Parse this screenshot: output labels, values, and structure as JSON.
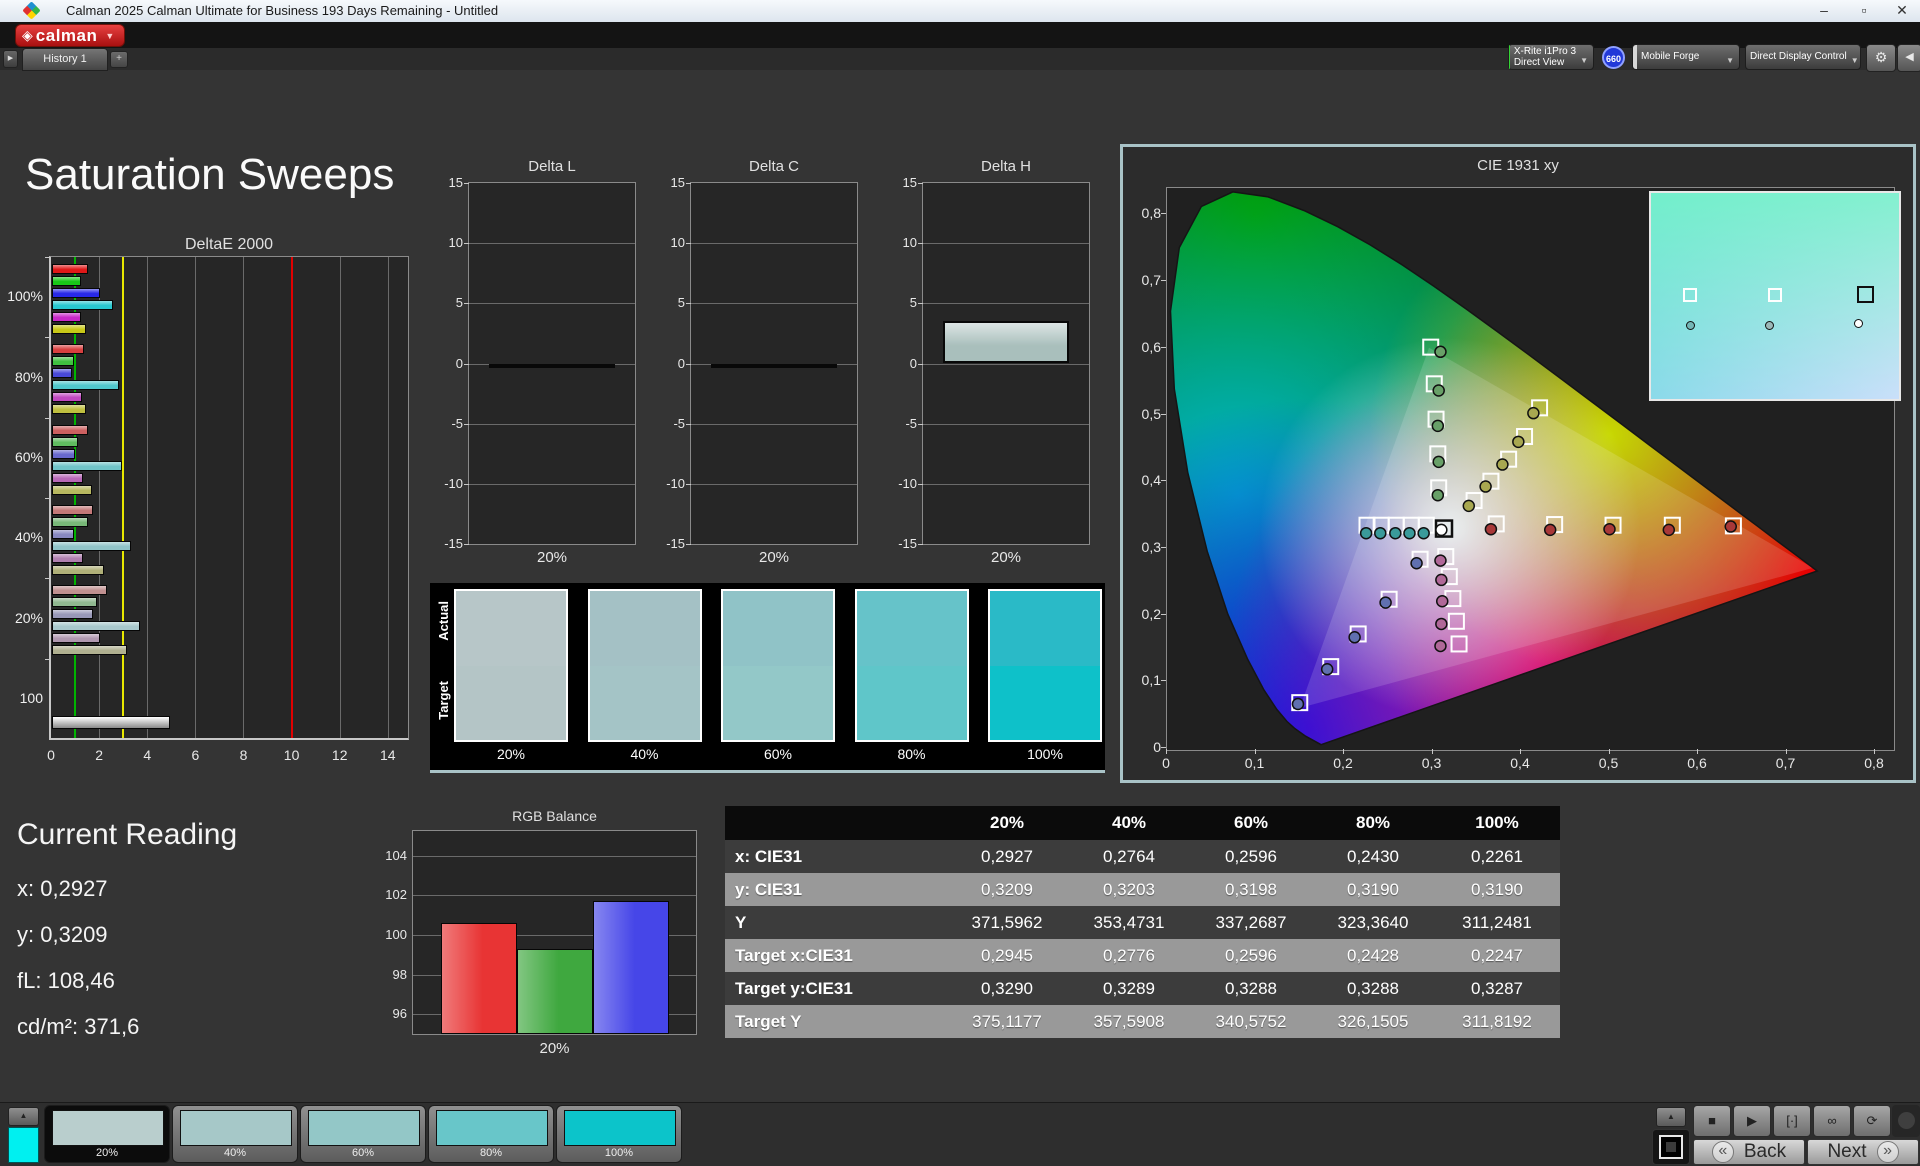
{
  "window": {
    "title": "Calman 2025 Calman Ultimate for Business 193 Days Remaining  - Untitled",
    "minimize": "–",
    "maximize": "▫",
    "close": "✕"
  },
  "logo": {
    "text": "calman",
    "diamond": "◈",
    "caret": "▼"
  },
  "tabs": {
    "scroll_arrow": "▶",
    "history_tab": "History 1",
    "add_tab": "+"
  },
  "toolbar": {
    "meter_line1": "X-Rite i1Pro 3",
    "meter_line2": "Direct View",
    "meter_stripe": "#35d435",
    "badge": "660",
    "source_label": "Mobile Forge",
    "source_stripe": "#d8d8d8",
    "display_label": "Direct Display Control",
    "display_stripe": "#e8d820",
    "gear_icon": "⚙",
    "collapse_icon": "◀",
    "caret": "▼"
  },
  "page": {
    "title": "Saturation Sweeps"
  },
  "current_reading": {
    "title": "Current Reading",
    "lines": [
      {
        "label": "x:",
        "value": "0,2927"
      },
      {
        "label": "y:",
        "value": "0,3209"
      },
      {
        "label": "fL:",
        "value": "108,46"
      },
      {
        "label": "cd/m²:",
        "value": "371,6"
      }
    ]
  },
  "swatches": {
    "row_labels": [
      "Actual",
      "Target"
    ],
    "levels": [
      {
        "label": "20%",
        "actual": "#b7c6c8",
        "target": "#b4c5c6"
      },
      {
        "label": "40%",
        "actual": "#a4c1c5",
        "target": "#a4c4c6"
      },
      {
        "label": "60%",
        "actual": "#90c3c7",
        "target": "#93c8c8"
      },
      {
        "label": "80%",
        "actual": "#66c3c9",
        "target": "#5fc6c9"
      },
      {
        "label": "100%",
        "actual": "#2abac7",
        "target": "#0ec1c9"
      }
    ]
  },
  "chart_data": [
    {
      "id": "deltae2000",
      "type": "bar",
      "orientation": "horizontal",
      "title": "DeltaE 2000",
      "xlim": [
        0,
        14.88
      ],
      "xticks": [
        0,
        2,
        4,
        6,
        8,
        10,
        12,
        14
      ],
      "grid": true,
      "reference_lines": [
        {
          "value": 1,
          "color": "#00b400"
        },
        {
          "value": 3,
          "color": "#e8e800"
        },
        {
          "value": 10,
          "color": "#e00000"
        }
      ],
      "series_names": [
        "red",
        "green",
        "blue",
        "cyan",
        "magenta",
        "yellow"
      ],
      "groups": [
        {
          "label": "100%",
          "values": [
            1.5,
            1.2,
            2.0,
            2.55,
            1.2,
            1.4
          ],
          "colors": [
            "#e01818",
            "#18c818",
            "#2828e8",
            "#28c8d0",
            "#c828c8",
            "#c8c818"
          ]
        },
        {
          "label": "80%",
          "values": [
            1.35,
            0.9,
            0.85,
            2.8,
            1.25,
            1.4
          ],
          "colors": [
            "#d84040",
            "#40c040",
            "#4848d8",
            "#50c8cc",
            "#c048c0",
            "#c0c040"
          ]
        },
        {
          "label": "60%",
          "values": [
            1.5,
            1.1,
            0.95,
            2.9,
            1.3,
            1.65
          ],
          "colors": [
            "#cc6060",
            "#60bc60",
            "#6868cc",
            "#70c4c8",
            "#b868b8",
            "#b8b860"
          ]
        },
        {
          "label": "40%",
          "values": [
            1.7,
            1.5,
            0.9,
            3.3,
            1.3,
            2.15
          ],
          "colors": [
            "#c47878",
            "#78b878",
            "#8888c0",
            "#90c4c8",
            "#b080b0",
            "#b0b078"
          ]
        },
        {
          "label": "20%",
          "values": [
            2.3,
            1.85,
            1.7,
            3.65,
            2.0,
            3.1
          ],
          "colors": [
            "#c09090",
            "#90b890",
            "#9898b8",
            "#a8c8cc",
            "#b098b0",
            "#b0b090"
          ]
        },
        {
          "label": "100",
          "values": [
            4.9
          ],
          "colors": [
            "#e8e8e8"
          ]
        }
      ]
    },
    {
      "id": "delta_l",
      "type": "bar",
      "title": "Delta L",
      "categories": [
        "20%"
      ],
      "values": [
        -0.15
      ],
      "ylim": [
        -15,
        15
      ],
      "yticks": [
        15,
        10,
        5,
        0,
        -5,
        -10,
        -15
      ],
      "bar_color": "#dfe8e8",
      "xlabel": "20%"
    },
    {
      "id": "delta_c",
      "type": "bar",
      "title": "Delta C",
      "categories": [
        "20%"
      ],
      "values": [
        -0.35
      ],
      "ylim": [
        -15,
        15
      ],
      "yticks": [
        15,
        10,
        5,
        0,
        -5,
        -10,
        -15
      ],
      "bar_color": "#dfe8e8",
      "xlabel": "20%"
    },
    {
      "id": "delta_h",
      "type": "bar",
      "title": "Delta H",
      "categories": [
        "20%"
      ],
      "values": [
        3.5
      ],
      "ylim": [
        -15,
        15
      ],
      "yticks": [
        15,
        10,
        5,
        0,
        -5,
        -10,
        -15
      ],
      "bar_color": "#a9bfbc",
      "xlabel": "20%"
    },
    {
      "id": "rgb_balance",
      "type": "bar",
      "title": "RGB Balance",
      "xlabel": "20%",
      "categories": [
        "R",
        "G",
        "B"
      ],
      "values": [
        100.6,
        99.3,
        101.7
      ],
      "colors": [
        "#e83434",
        "#3fa83f",
        "#4646e8"
      ],
      "ylim": [
        95,
        105.25
      ],
      "yticks": [
        104,
        102,
        100,
        98,
        96
      ]
    },
    {
      "id": "cie1931",
      "type": "scatter",
      "title": "CIE 1931 xy",
      "xlim": [
        0,
        0.82
      ],
      "ylim": [
        0,
        0.84
      ],
      "xticks": [
        0,
        0.1,
        0.2,
        0.3,
        0.4,
        0.5,
        0.6,
        0.7,
        0.8
      ],
      "yticks": [
        0,
        0.1,
        0.2,
        0.3,
        0.4,
        0.5,
        0.6,
        0.7,
        0.8
      ],
      "white_target": [
        0.313,
        0.329
      ],
      "white_measured": [
        0.31,
        0.327
      ],
      "sweeps": [
        {
          "name": "red",
          "dot_color": "#a83838",
          "targets": [
            [
              0.372,
              0.336
            ],
            [
              0.438,
              0.335
            ],
            [
              0.504,
              0.334
            ],
            [
              0.571,
              0.334
            ],
            [
              0.64,
              0.333
            ]
          ],
          "measured": [
            [
              0.366,
              0.328
            ],
            [
              0.433,
              0.327
            ],
            [
              0.5,
              0.328
            ],
            [
              0.567,
              0.327
            ],
            [
              0.637,
              0.332
            ]
          ]
        },
        {
          "name": "green",
          "dot_color": "#68a068",
          "targets": [
            [
              0.307,
              0.39
            ],
            [
              0.306,
              0.441
            ],
            [
              0.304,
              0.493
            ],
            [
              0.302,
              0.546
            ],
            [
              0.298,
              0.601
            ]
          ],
          "measured": [
            [
              0.306,
              0.379
            ],
            [
              0.307,
              0.429
            ],
            [
              0.306,
              0.483
            ],
            [
              0.307,
              0.536
            ],
            [
              0.309,
              0.594
            ]
          ]
        },
        {
          "name": "blue",
          "dot_color": "#6070b0",
          "targets": [
            [
              0.286,
              0.283
            ],
            [
              0.251,
              0.223
            ],
            [
              0.216,
              0.171
            ],
            [
              0.185,
              0.122
            ],
            [
              0.15,
              0.068
            ]
          ],
          "measured": [
            [
              0.282,
              0.277
            ],
            [
              0.247,
              0.218
            ],
            [
              0.212,
              0.166
            ],
            [
              0.181,
              0.118
            ],
            [
              0.148,
              0.066
            ]
          ]
        },
        {
          "name": "cyan",
          "dot_color": "#3a9a9a",
          "targets": [
            [
              0.293,
              0.334
            ],
            [
              0.276,
              0.334
            ],
            [
              0.259,
              0.334
            ],
            [
              0.242,
              0.334
            ],
            [
              0.226,
              0.334
            ]
          ],
          "measured": [
            [
              0.29,
              0.322
            ],
            [
              0.274,
              0.322
            ],
            [
              0.258,
              0.322
            ],
            [
              0.241,
              0.322
            ],
            [
              0.225,
              0.322
            ]
          ]
        },
        {
          "name": "magenta",
          "dot_color": "#b06898",
          "targets": [
            [
              0.315,
              0.287
            ],
            [
              0.319,
              0.257
            ],
            [
              0.323,
              0.224
            ],
            [
              0.327,
              0.19
            ],
            [
              0.33,
              0.156
            ]
          ],
          "measured": [
            [
              0.309,
              0.281
            ],
            [
              0.31,
              0.252
            ],
            [
              0.311,
              0.22
            ],
            [
              0.31,
              0.186
            ],
            [
              0.309,
              0.153
            ]
          ]
        },
        {
          "name": "yellow",
          "dot_color": "#a8a850",
          "targets": [
            [
              0.347,
              0.371
            ],
            [
              0.366,
              0.4
            ],
            [
              0.386,
              0.433
            ],
            [
              0.404,
              0.467
            ],
            [
              0.421,
              0.51
            ]
          ],
          "measured": [
            [
              0.341,
              0.363
            ],
            [
              0.36,
              0.392
            ],
            [
              0.379,
              0.425
            ],
            [
              0.397,
              0.459
            ],
            [
              0.414,
              0.502
            ]
          ]
        }
      ],
      "inset": {
        "squares": [
          {
            "x": 13,
            "y": 46,
            "current": false
          },
          {
            "x": 47,
            "y": 46,
            "current": false
          },
          {
            "x": 83,
            "y": 45,
            "current": true
          }
        ],
        "circles": [
          {
            "x": 14,
            "y": 62,
            "color": "#74b6b6"
          },
          {
            "x": 46,
            "y": 62,
            "color": "#9cb8b8"
          },
          {
            "x": 82,
            "y": 61,
            "color": "#ffffff"
          }
        ]
      }
    }
  ],
  "table": {
    "headers": [
      "",
      "20%",
      "40%",
      "60%",
      "80%",
      "100%"
    ],
    "rows": [
      {
        "label": "x: CIE31",
        "values": [
          "0,2927",
          "0,2764",
          "0,2596",
          "0,2430",
          "0,2261"
        ]
      },
      {
        "label": "y: CIE31",
        "values": [
          "0,3209",
          "0,3203",
          "0,3198",
          "0,3190",
          "0,3190"
        ]
      },
      {
        "label": "Y",
        "values": [
          "371,5962",
          "353,4731",
          "337,2687",
          "323,3640",
          "311,2481"
        ]
      },
      {
        "label": "Target x:CIE31",
        "values": [
          "0,2945",
          "0,2776",
          "0,2596",
          "0,2428",
          "0,2247"
        ]
      },
      {
        "label": "Target y:CIE31",
        "values": [
          "0,3290",
          "0,3289",
          "0,3288",
          "0,3288",
          "0,3287"
        ]
      },
      {
        "label": "Target Y",
        "values": [
          "375,1177",
          "357,5908",
          "340,5752",
          "326,1505",
          "311,8192"
        ]
      }
    ]
  },
  "footer": {
    "eye_arrow": "▲",
    "swatch_color": "#00f0f0",
    "thumbnails": [
      {
        "label": "20%",
        "color": "#b9cecd",
        "selected": true
      },
      {
        "label": "40%",
        "color": "#a6c8c8",
        "selected": false
      },
      {
        "label": "60%",
        "color": "#93c7c7",
        "selected": false
      },
      {
        "label": "80%",
        "color": "#68c6c9",
        "selected": false
      },
      {
        "label": "100%",
        "color": "#0cc4ca",
        "selected": false
      }
    ],
    "chevron_up": "▲",
    "transport": [
      {
        "name": "stop",
        "glyph": "■"
      },
      {
        "name": "play",
        "glyph": "▶"
      },
      {
        "name": "measure-single",
        "glyph": "[·]"
      },
      {
        "name": "measure-continuous",
        "glyph": "∞"
      },
      {
        "name": "refresh",
        "glyph": "⟳"
      }
    ],
    "back_label": "Back",
    "next_label": "Next",
    "back_chev": "«",
    "next_chev": "»"
  }
}
